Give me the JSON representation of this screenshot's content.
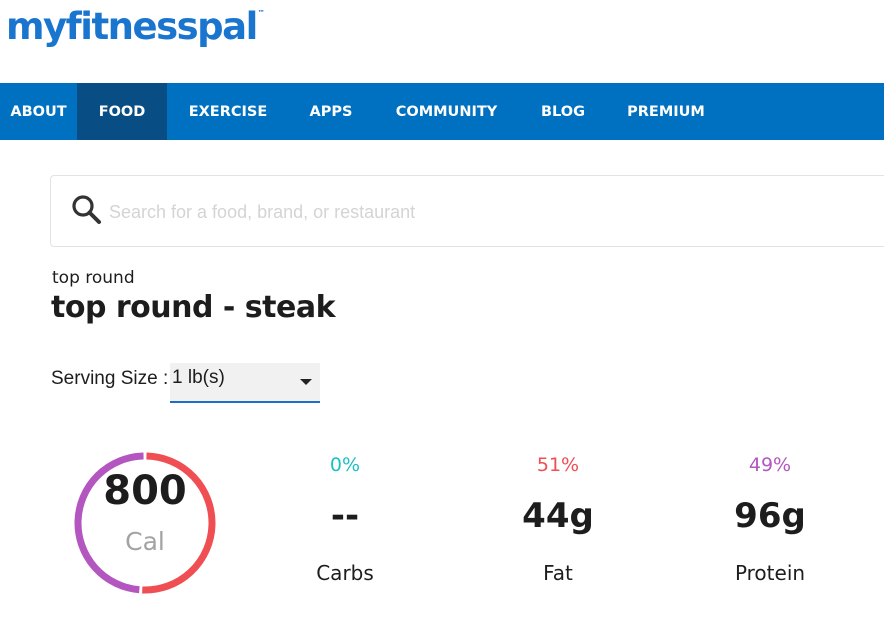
{
  "header": {
    "logo_text": "myfitnesspal",
    "trademark": "™"
  },
  "nav": {
    "items": [
      {
        "label": "ABOUT",
        "active": false
      },
      {
        "label": "FOOD",
        "active": true
      },
      {
        "label": "EXERCISE",
        "active": false
      },
      {
        "label": "APPS",
        "active": false
      },
      {
        "label": "COMMUNITY",
        "active": false
      },
      {
        "label": "BLOG",
        "active": false
      },
      {
        "label": "PREMIUM",
        "active": false
      }
    ]
  },
  "search": {
    "placeholder": "Search for a food, brand, or restaurant",
    "value": "",
    "icon": "search-icon"
  },
  "food": {
    "brand": "top round",
    "title": "top round - steak"
  },
  "serving": {
    "label": "Serving Size :",
    "selected": "1 lb(s)"
  },
  "calories": {
    "value": "800",
    "unit": "Cal",
    "ring_segments": [
      {
        "name": "fat",
        "fraction": 0.51,
        "color": "#ef4e53"
      },
      {
        "name": "protein",
        "fraction": 0.49,
        "color": "#b456c0"
      }
    ]
  },
  "macros": [
    {
      "key": "carbs",
      "percent": "0%",
      "amount": "--",
      "name": "Carbs",
      "color": "#1cc0c6"
    },
    {
      "key": "fat",
      "percent": "51%",
      "amount": "44g",
      "name": "Fat",
      "color": "#ef4e53"
    },
    {
      "key": "protein",
      "percent": "49%",
      "amount": "96g",
      "name": "Protein",
      "color": "#b456c0"
    }
  ]
}
